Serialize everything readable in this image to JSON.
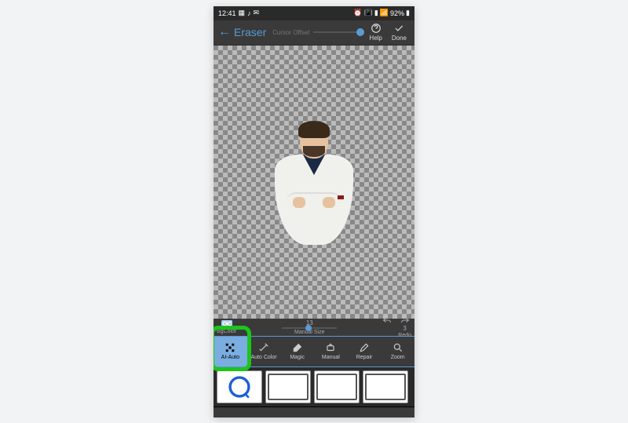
{
  "status": {
    "time": "12:41",
    "battery": "92%"
  },
  "header": {
    "title": "Eraser",
    "cursor_offset_label": "Cursor Offset",
    "help": "Help",
    "done": "Done"
  },
  "settings": {
    "bgcolor": "BgColor",
    "manual_size": "Manual Size",
    "size_value": "13",
    "redo_count": "3",
    "redo_label": "Redo"
  },
  "tools": {
    "ai_auto": "AI-Auto",
    "auto_color": "Auto Color",
    "magic": "Magic",
    "manual": "Manual",
    "repair": "Repair",
    "zoom": "Zoom"
  }
}
